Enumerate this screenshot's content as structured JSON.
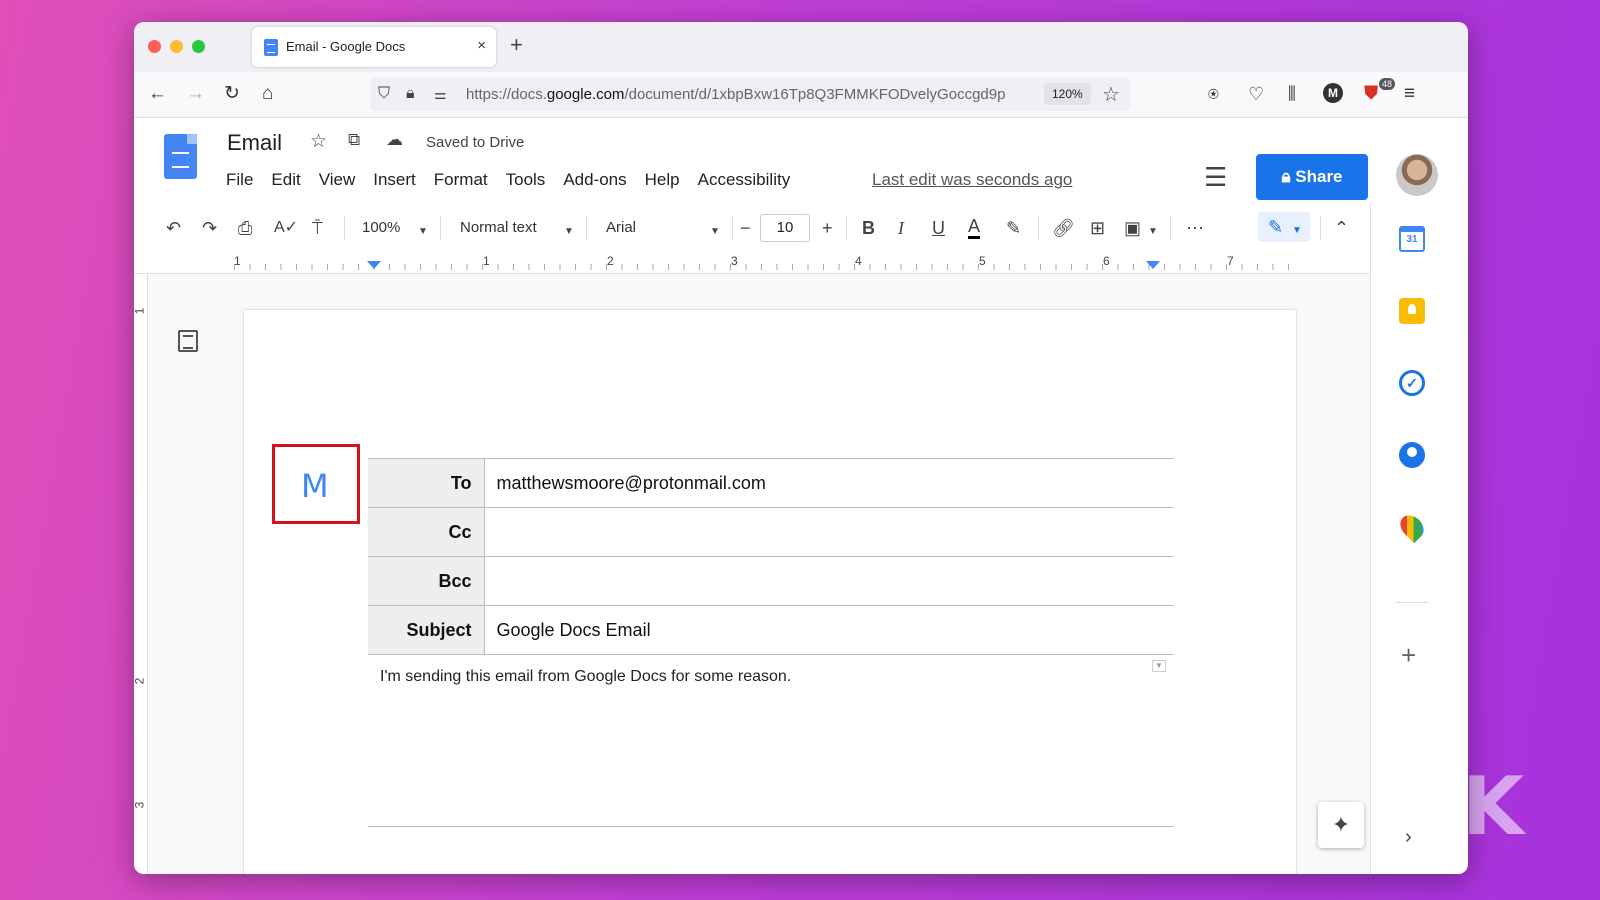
{
  "browser": {
    "tab_title": "Email - Google Docs",
    "tab_close": "×",
    "new_tab": "+",
    "url_prefix": "https://docs.",
    "url_domain": "google.com",
    "url_path": "/document/d/1xbpBxw16Tp8Q3FMMKFODvelyGoccgd9p",
    "zoom": "120%",
    "badge_count": "48",
    "profile_initial": "M"
  },
  "docs": {
    "title": "Email",
    "saved_status": "Saved to Drive",
    "menu": [
      "File",
      "Edit",
      "View",
      "Insert",
      "Format",
      "Tools",
      "Add-ons",
      "Help",
      "Accessibility"
    ],
    "last_edit": "Last edit was seconds ago",
    "share_label": "Share"
  },
  "toolbar": {
    "zoom": "100%",
    "style": "Normal text",
    "font": "Arial",
    "font_size": "10"
  },
  "ruler": {
    "numbers": [
      "1",
      "1",
      "2",
      "3",
      "4",
      "5",
      "6",
      "7"
    ],
    "vertical_numbers": [
      "1",
      "2",
      "3"
    ]
  },
  "email": {
    "rows": [
      {
        "label": "To",
        "value": "matthewsmoore@protonmail.com"
      },
      {
        "label": "Cc",
        "value": ""
      },
      {
        "label": "Bcc",
        "value": ""
      },
      {
        "label": "Subject",
        "value": "Google Docs Email"
      }
    ],
    "body": "I'm sending this email from Google Docs for some reason."
  },
  "colors": {
    "share_blue": "#1a73e8",
    "highlight_red": "#d0131a",
    "gmail_blue": "#4285f4"
  }
}
